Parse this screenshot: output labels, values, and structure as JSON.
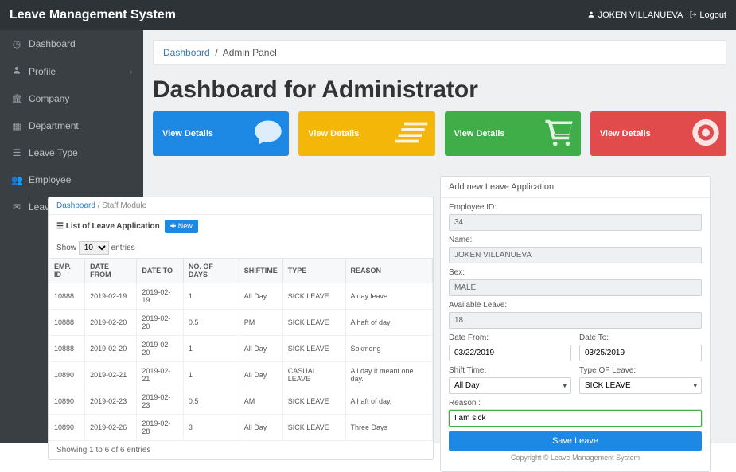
{
  "header": {
    "brand": "Leave Management System",
    "username": "JOKEN VILLANUEVA",
    "logout_label": "Logout"
  },
  "sidebar": {
    "items": [
      {
        "label": "Dashboard",
        "icon": "dashboard-icon"
      },
      {
        "label": "Profile",
        "icon": "user-icon",
        "has_children": true
      },
      {
        "label": "Company",
        "icon": "building-icon"
      },
      {
        "label": "Department",
        "icon": "grid-icon"
      },
      {
        "label": "Leave Type",
        "icon": "list-icon"
      },
      {
        "label": "Employee",
        "icon": "users-icon"
      },
      {
        "label": "Leave",
        "icon": "calendar-icon"
      }
    ]
  },
  "breadcrumb": {
    "root": "Dashboard",
    "sep": "/",
    "current": "Admin Panel"
  },
  "page_title": "Dashboard for Administrator",
  "cards": [
    {
      "label": "View Details",
      "color": "blue"
    },
    {
      "label": "View Details",
      "color": "yellow"
    },
    {
      "label": "View Details",
      "color": "green"
    },
    {
      "label": "View Details",
      "color": "red"
    }
  ],
  "table_panel": {
    "crumb_partial": "Staff Module",
    "title_prefix": "☰",
    "title": "List of Leave Application",
    "new_btn_label": "✚ New",
    "show_label_before": "Show",
    "show_value": "10",
    "show_label_after": "entries",
    "columns": [
      "EMP. ID",
      "DATE FROM",
      "DATE TO",
      "NO. OF DAYS",
      "SHIFTIME",
      "TYPE",
      "REASON"
    ],
    "rows": [
      [
        "10888",
        "2019-02-19",
        "2019-02-19",
        "1",
        "All Day",
        "SICK LEAVE",
        "A day leave"
      ],
      [
        "10888",
        "2019-02-20",
        "2019-02-20",
        "0.5",
        "PM",
        "SICK LEAVE",
        "A haft of day"
      ],
      [
        "10888",
        "2019-02-20",
        "2019-02-20",
        "1",
        "All Day",
        "SICK LEAVE",
        "Sokmeng"
      ],
      [
        "10890",
        "2019-02-21",
        "2019-02-21",
        "1",
        "All Day",
        "CASUAL LEAVE",
        "All day it meant one day."
      ],
      [
        "10890",
        "2019-02-23",
        "2019-02-23",
        "0.5",
        "AM",
        "SICK LEAVE",
        "A haft of day."
      ],
      [
        "10890",
        "2019-02-26",
        "2019-02-28",
        "3",
        "All Day",
        "SICK LEAVE",
        "Three Days"
      ]
    ],
    "footer": "Showing 1 to 6 of 6 entries"
  },
  "form_panel": {
    "title": "Add new Leave Application",
    "labels": {
      "emp_id": "Employee ID:",
      "name": "Name:",
      "sex": "Sex:",
      "available": "Available Leave:",
      "date_from": "Date From:",
      "date_to": "Date To:",
      "shift": "Shift Time:",
      "type": "Type OF Leave:",
      "reason": "Reason :"
    },
    "values": {
      "emp_id": "34",
      "name": "JOKEN VILLANUEVA",
      "sex": "MALE",
      "available": "18",
      "date_from": "03/22/2019",
      "date_to": "03/25/2019",
      "shift": "All Day",
      "type": "SICK LEAVE",
      "reason": "I am sick"
    },
    "save_label": "Save Leave",
    "copyright": "Copyright © Leave Management System"
  }
}
